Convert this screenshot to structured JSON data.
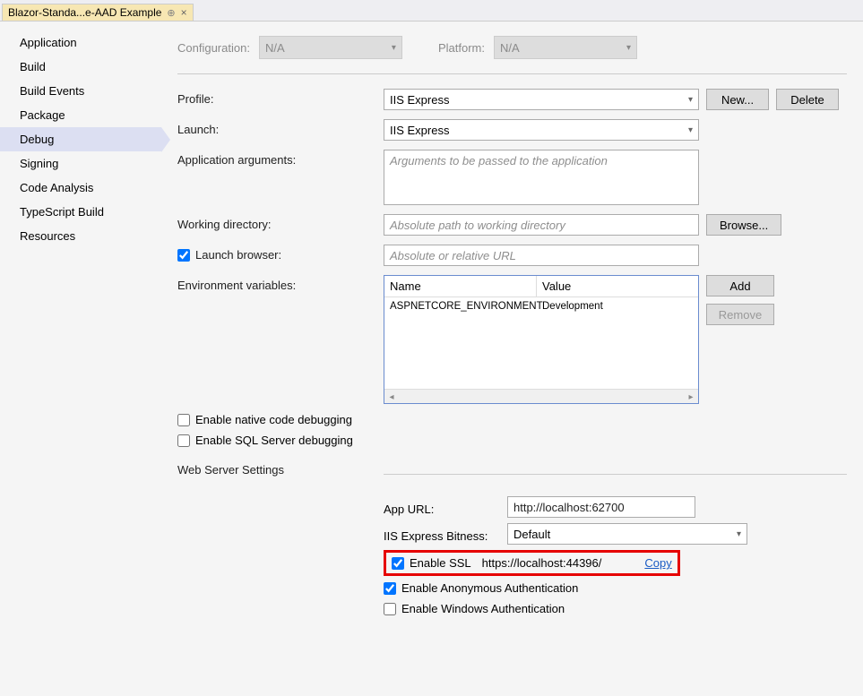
{
  "tab": {
    "title": "Blazor-Standa...e-AAD Example"
  },
  "sidebar": {
    "items": [
      {
        "label": "Application"
      },
      {
        "label": "Build"
      },
      {
        "label": "Build Events"
      },
      {
        "label": "Package"
      },
      {
        "label": "Debug"
      },
      {
        "label": "Signing"
      },
      {
        "label": "Code Analysis"
      },
      {
        "label": "TypeScript Build"
      },
      {
        "label": "Resources"
      }
    ],
    "selected_index": 4
  },
  "toprow": {
    "configuration_label": "Configuration:",
    "configuration_value": "N/A",
    "platform_label": "Platform:",
    "platform_value": "N/A"
  },
  "form": {
    "profile_label": "Profile:",
    "profile_value": "IIS Express",
    "new_btn": "New...",
    "delete_btn": "Delete",
    "launch_label": "Launch:",
    "launch_value": "IIS Express",
    "app_args_label": "Application arguments:",
    "app_args_placeholder": "Arguments to be passed to the application",
    "workdir_label": "Working directory:",
    "workdir_placeholder": "Absolute path to working directory",
    "browse_btn": "Browse...",
    "launch_browser_label": "Launch browser:",
    "launch_browser_checked": true,
    "launch_browser_placeholder": "Absolute or relative URL",
    "env_label": "Environment variables:",
    "env_headers": {
      "name": "Name",
      "value": "Value"
    },
    "env_rows": [
      {
        "name": "ASPNETCORE_ENVIRONMENT",
        "value": "Development"
      }
    ],
    "add_btn": "Add",
    "remove_btn": "Remove",
    "native_debug": {
      "label": "Enable native code debugging",
      "checked": false
    },
    "sql_debug": {
      "label": "Enable SQL Server debugging",
      "checked": false
    }
  },
  "web": {
    "section_title": "Web Server Settings",
    "app_url_label": "App URL:",
    "app_url_value": "http://localhost:62700",
    "bitness_label": "IIS Express Bitness:",
    "bitness_value": "Default",
    "enable_ssl_label": "Enable SSL",
    "enable_ssl_checked": true,
    "ssl_url": "https://localhost:44396/",
    "copy_link": "Copy",
    "anon_auth": {
      "label": "Enable Anonymous Authentication",
      "checked": true
    },
    "win_auth": {
      "label": "Enable Windows Authentication",
      "checked": false
    }
  }
}
